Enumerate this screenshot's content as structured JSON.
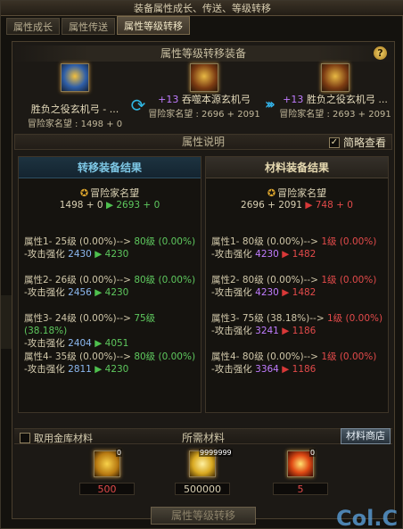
{
  "window_title": "装备属性成长、传送、等级转移",
  "tabs": [
    {
      "label": "属性成长",
      "active": false
    },
    {
      "label": "属性传送",
      "active": false
    },
    {
      "label": "属性等级转移",
      "active": true
    }
  ],
  "header": {
    "title": "属性等级转移装备",
    "help_icon": "?"
  },
  "source_equip": {
    "name": "胜负之役玄机弓 - ...",
    "rep_label": "冒险家名望",
    "rep_value": "1498 + 0"
  },
  "target_equip": {
    "plus": "+13",
    "name": "吞噬本源玄机弓",
    "rep_label": "冒险家名望",
    "rep_value": "2696 + 2091"
  },
  "result_equip": {
    "plus": "+13",
    "name": "胜负之役玄机弓 ...",
    "rep_label": "冒险家名望",
    "rep_value": "2693 + 2091"
  },
  "attr_desc": {
    "title": "属性说明",
    "checkbox_label": "简略查看",
    "checked": true
  },
  "left_col": {
    "title": "转移装备结果",
    "rep_title": "冒险家名望",
    "rep_from": "1498 + 0",
    "rep_to": "2693 + 0",
    "attrs": [
      {
        "name": "属性1-",
        "from": "25级 (0.00%)",
        "arrow": "-->",
        "to": "80级 (0.00%)",
        "stat": "-攻击强化",
        "val_from": "2430",
        "val_to": "4230"
      },
      {
        "name": "属性2-",
        "from": "26级 (0.00%)",
        "arrow": "-->",
        "to": "80级 (0.00%)",
        "stat": "-攻击强化",
        "val_from": "2456",
        "val_to": "4230"
      },
      {
        "name": "属性3-",
        "from": "24级 (0.00%)",
        "arrow": "-->",
        "to": "75级 (38.18%)",
        "stat": "-攻击强化",
        "val_from": "2404",
        "val_to": "4051"
      },
      {
        "name": "属性4-",
        "from": "35级 (0.00%)",
        "arrow": "-->",
        "to": "80级 (0.00%)",
        "stat": "-攻击强化",
        "val_from": "2811",
        "val_to": "4230"
      }
    ]
  },
  "right_col": {
    "title": "材料装备结果",
    "rep_title": "冒险家名望",
    "rep_from": "2696 + 2091",
    "rep_to": "748 + 0",
    "attrs": [
      {
        "name": "属性1-",
        "from": "80级 (0.00%)",
        "arrow": "-->",
        "to": "1级 (0.00%)",
        "stat": "-攻击强化",
        "val_from": "4230",
        "val_to": "1482"
      },
      {
        "name": "属性2-",
        "from": "80级 (0.00%)",
        "arrow": "-->",
        "to": "1级 (0.00%)",
        "stat": "-攻击强化",
        "val_from": "4230",
        "val_to": "1482"
      },
      {
        "name": "属性3-",
        "from": "75级 (38.18%)",
        "arrow": "-->",
        "to": "1级 (0.00%)",
        "stat": "-攻击强化",
        "val_from": "3241",
        "val_to": "1186"
      },
      {
        "name": "属性4-",
        "from": "80级 (0.00%)",
        "arrow": "-->",
        "to": "1级 (0.00%)",
        "stat": "-攻击强化",
        "val_from": "3364",
        "val_to": "1186"
      }
    ]
  },
  "materials_bar": {
    "gold_checkbox": "取用金库材料",
    "title": "所需材料",
    "shop_button": "材料商店"
  },
  "materials": [
    {
      "icon": "scroll-icon",
      "stock": "0",
      "required": "500"
    },
    {
      "icon": "gold-coins-icon",
      "stock": "9999999",
      "required": "500000"
    },
    {
      "icon": "flame-orb-icon",
      "stock": "0",
      "required": "5"
    }
  ],
  "confirm_button": "属性等级转移",
  "watermark": "Col.C",
  "colors": {
    "gain": "#5ec85e",
    "loss": "#e24a4a",
    "enhance": "#c56cff",
    "accent_blue": "#7ec8e6"
  }
}
